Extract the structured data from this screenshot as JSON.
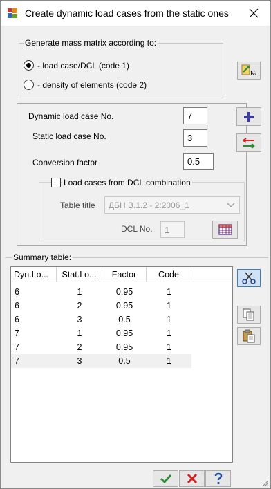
{
  "window": {
    "title": "Create dynamic load cases from the static ones",
    "close_glyph": "✕"
  },
  "mass_group": {
    "legend": "Generate mass matrix according to:",
    "radio1_label": "- load case/DCL (code 1)",
    "radio2_label": "- density of elements (code 2)"
  },
  "params": {
    "dynamic_label": "Dynamic load case No.",
    "dynamic_value": "7",
    "static_label": "Static load case No.",
    "static_value": "3",
    "factor_label": "Conversion factor",
    "factor_value": "0.5"
  },
  "dcl_group": {
    "checkbox_label": "Load cases from DCL combination",
    "table_title_label": "Table title",
    "table_title_value": "ДБН В.1.2 - 2:2006_1",
    "dcl_no_label": "DCL No.",
    "dcl_no_value": "1"
  },
  "summary": {
    "legend": "Summary table:",
    "columns": [
      "Dyn.Lo...",
      "Stat.Lo...",
      "Factor",
      "Code"
    ],
    "rows": [
      [
        "6",
        "1",
        "0.95",
        "1"
      ],
      [
        "6",
        "2",
        "0.95",
        "1"
      ],
      [
        "6",
        "3",
        "0.5",
        "1"
      ],
      [
        "7",
        "1",
        "0.95",
        "1"
      ],
      [
        "7",
        "2",
        "0.95",
        "1"
      ],
      [
        "7",
        "3",
        "0.5",
        "1"
      ]
    ]
  },
  "icons": {
    "mass_button": "book-number-icon",
    "add": "plus-icon",
    "swap": "swap-arrows-icon",
    "dcl_table": "grid-table-icon",
    "cut": "scissors-icon",
    "copy": "copy-icon",
    "paste": "paste-icon",
    "ok": "checkmark-icon",
    "cancel": "cross-icon",
    "help": "question-icon"
  },
  "colors": {
    "accent_blue": "#3c3c9c",
    "ok_green": "#2e8b3a",
    "cancel_red": "#d21f1f",
    "help_blue": "#1f4fa0"
  }
}
